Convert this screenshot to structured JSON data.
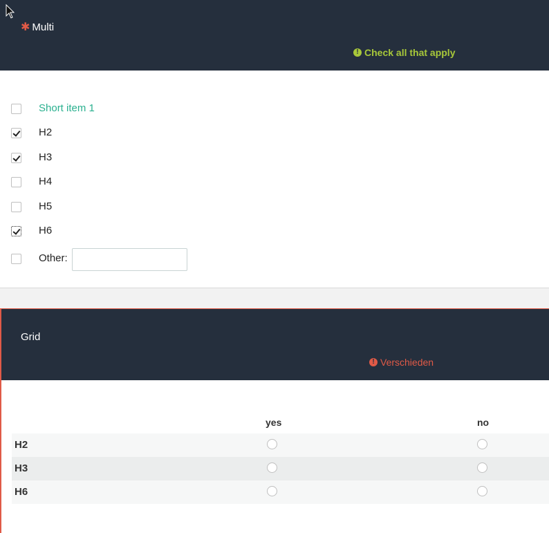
{
  "question1": {
    "title": "Multi",
    "required_icon": "asterisk-icon",
    "hint_icon": "exclamation-circle-icon",
    "hint": "Check all that apply",
    "options": [
      {
        "label": "Short item 1",
        "checked": false
      },
      {
        "label": "H2",
        "checked": true
      },
      {
        "label": "H3",
        "checked": true
      },
      {
        "label": "H4",
        "checked": false
      },
      {
        "label": "H5",
        "checked": false
      },
      {
        "label": "H6",
        "checked": true,
        "focused": true
      }
    ],
    "other": {
      "label": "Other:",
      "value": "",
      "checked": false
    }
  },
  "question2": {
    "title": "Grid",
    "hint_icon": "exclamation-circle-icon",
    "hint": "Verschieden",
    "columns": [
      "yes",
      "no"
    ],
    "rows": [
      "H2",
      "H3",
      "H6"
    ]
  },
  "colors": {
    "header_bg": "#252f3d",
    "accent_green": "#a8c83a",
    "error_red": "#e05a47",
    "link_teal": "#2ab08f"
  }
}
